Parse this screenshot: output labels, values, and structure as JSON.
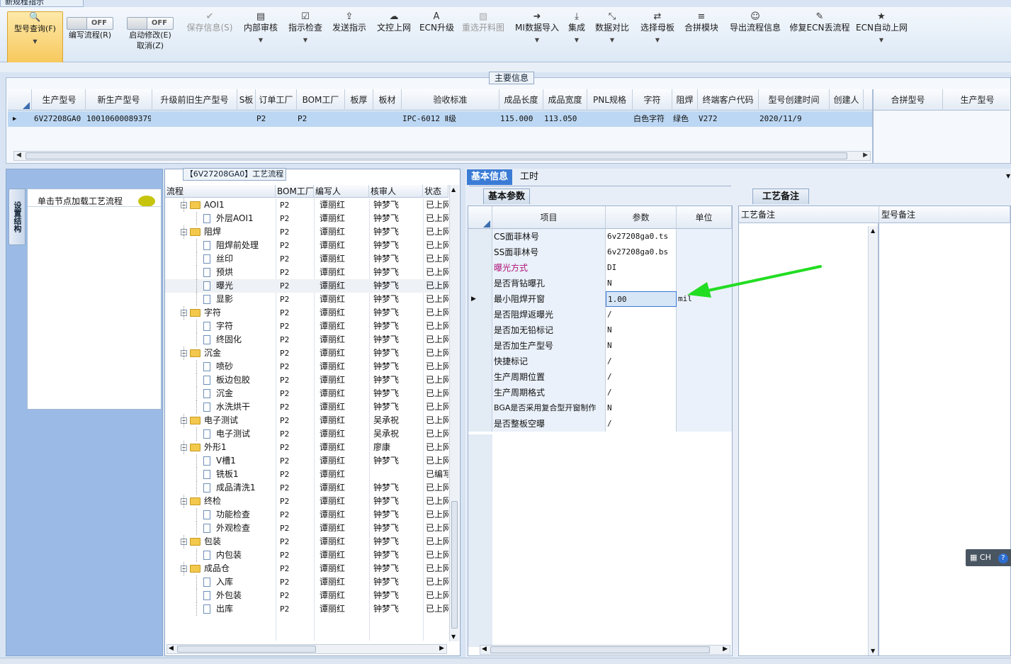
{
  "window": {
    "title": "新规程指示"
  },
  "toolbar": {
    "query": "型号查询(F)",
    "write_toggle": "OFF",
    "write": "编写流程(R)",
    "start_toggle": "OFF",
    "start": "启动修改(E)",
    "cancel": "取消(Z)",
    "items": [
      {
        "label": "保存信息(S)",
        "icon": "check-icon"
      },
      {
        "label": "内部审核",
        "icon": "print-icon"
      },
      {
        "label": "指示检查",
        "icon": "checkbox-icon"
      },
      {
        "label": "发送指示",
        "icon": "upload-icon"
      },
      {
        "label": "文控上网",
        "icon": "cloud-upload-icon"
      },
      {
        "label": "ECN升级",
        "icon": "font-icon"
      },
      {
        "label": "重选开料图",
        "icon": "image-icon"
      },
      {
        "label": "MI数据导入",
        "icon": "sign-in-icon"
      },
      {
        "label": "集成",
        "icon": "download-icon"
      },
      {
        "label": "数据对比",
        "icon": "compress-icon"
      },
      {
        "label": "选择母板",
        "icon": "random-icon"
      },
      {
        "label": "合拼模块",
        "icon": "list-icon"
      },
      {
        "label": "导出流程信息",
        "icon": "smile-icon"
      },
      {
        "label": "修复ECN丢流程",
        "icon": "wrench-icon"
      },
      {
        "label": "ECN自动上网",
        "icon": "star-icon"
      }
    ]
  },
  "main": {
    "section_title": "主要信息",
    "columns": [
      "生产型号",
      "新生产型号",
      "升级前旧生产型号",
      "S板",
      "订单工厂",
      "BOM工厂",
      "板厚",
      "板材",
      "验收标准",
      "成品长度",
      "成品宽度",
      "PNL规格",
      "字符",
      "阻焊",
      "终端客户代码",
      "型号创建时间",
      "创建人"
    ],
    "row": [
      "6V27208GA0",
      "10010600089379",
      "",
      "",
      "P2",
      "P2",
      "",
      "",
      "IPC-6012 Ⅱ级",
      "115.000",
      "113.050",
      "",
      "白色字符",
      "绿色",
      "V272",
      "2020/11/9",
      ""
    ],
    "side_columns": [
      "合拼型号",
      "生产型号"
    ]
  },
  "left": {
    "vertical_tab": "设置结构",
    "load_hint": "单击节点加载工艺流程"
  },
  "tree": {
    "title": "【6V27208GA0】工艺流程",
    "columns": [
      "流程",
      "BOM工厂",
      "编写人",
      "核审人",
      "状态"
    ],
    "rows": [
      {
        "name": "AOI1",
        "level": 0,
        "folder": true,
        "bom": "P2",
        "writer": "谭丽红",
        "reviewer": "钟梦飞",
        "status": "已上网"
      },
      {
        "name": "外层AOI1",
        "level": 1,
        "folder": false,
        "bom": "P2",
        "writer": "谭丽红",
        "reviewer": "钟梦飞",
        "status": "已上网"
      },
      {
        "name": "阻焊",
        "level": 0,
        "folder": true,
        "bom": "P2",
        "writer": "谭丽红",
        "reviewer": "钟梦飞",
        "status": "已上网"
      },
      {
        "name": "阻焊前处理",
        "level": 1,
        "folder": false,
        "bom": "P2",
        "writer": "谭丽红",
        "reviewer": "钟梦飞",
        "status": "已上网"
      },
      {
        "name": "丝印",
        "level": 1,
        "folder": false,
        "bom": "P2",
        "writer": "谭丽红",
        "reviewer": "钟梦飞",
        "status": "已上网"
      },
      {
        "name": "预烘",
        "level": 1,
        "folder": false,
        "bom": "P2",
        "writer": "谭丽红",
        "reviewer": "钟梦飞",
        "status": "已上网"
      },
      {
        "name": "曝光",
        "level": 1,
        "folder": false,
        "bom": "P2",
        "writer": "谭丽红",
        "reviewer": "钟梦飞",
        "status": "已上网",
        "selected": true
      },
      {
        "name": "显影",
        "level": 1,
        "folder": false,
        "bom": "P2",
        "writer": "谭丽红",
        "reviewer": "钟梦飞",
        "status": "已上网"
      },
      {
        "name": "字符",
        "level": 0,
        "folder": true,
        "bom": "P2",
        "writer": "谭丽红",
        "reviewer": "钟梦飞",
        "status": "已上网"
      },
      {
        "name": "字符",
        "level": 1,
        "folder": false,
        "bom": "P2",
        "writer": "谭丽红",
        "reviewer": "钟梦飞",
        "status": "已上网"
      },
      {
        "name": "终固化",
        "level": 1,
        "folder": false,
        "bom": "P2",
        "writer": "谭丽红",
        "reviewer": "钟梦飞",
        "status": "已上网"
      },
      {
        "name": "沉金",
        "level": 0,
        "folder": true,
        "bom": "P2",
        "writer": "谭丽红",
        "reviewer": "钟梦飞",
        "status": "已上网"
      },
      {
        "name": "喷砂",
        "level": 1,
        "folder": false,
        "bom": "P2",
        "writer": "谭丽红",
        "reviewer": "钟梦飞",
        "status": "已上网"
      },
      {
        "name": "板边包胶",
        "level": 1,
        "folder": false,
        "bom": "P2",
        "writer": "谭丽红",
        "reviewer": "钟梦飞",
        "status": "已上网"
      },
      {
        "name": "沉金",
        "level": 1,
        "folder": false,
        "bom": "P2",
        "writer": "谭丽红",
        "reviewer": "钟梦飞",
        "status": "已上网"
      },
      {
        "name": "水洗烘干",
        "level": 1,
        "folder": false,
        "bom": "P2",
        "writer": "谭丽红",
        "reviewer": "钟梦飞",
        "status": "已上网"
      },
      {
        "name": "电子测试",
        "level": 0,
        "folder": true,
        "bom": "P2",
        "writer": "谭丽红",
        "reviewer": "吴承祝",
        "status": "已上网"
      },
      {
        "name": "电子测试",
        "level": 1,
        "folder": false,
        "bom": "P2",
        "writer": "谭丽红",
        "reviewer": "吴承祝",
        "status": "已上网"
      },
      {
        "name": "外形1",
        "level": 0,
        "folder": true,
        "bom": "P2",
        "writer": "谭丽红",
        "reviewer": "廖康",
        "status": "已上网"
      },
      {
        "name": "V槽1",
        "level": 1,
        "folder": false,
        "bom": "P2",
        "writer": "谭丽红",
        "reviewer": "钟梦飞",
        "status": "已上网"
      },
      {
        "name": "铣板1",
        "level": 1,
        "folder": false,
        "bom": "P2",
        "writer": "谭丽红",
        "reviewer": "",
        "status": "已编写"
      },
      {
        "name": "成品清洗1",
        "level": 1,
        "folder": false,
        "bom": "P2",
        "writer": "谭丽红",
        "reviewer": "钟梦飞",
        "status": "已上网"
      },
      {
        "name": "终检",
        "level": 0,
        "folder": true,
        "bom": "P2",
        "writer": "谭丽红",
        "reviewer": "钟梦飞",
        "status": "已上网"
      },
      {
        "name": "功能检查",
        "level": 1,
        "folder": false,
        "bom": "P2",
        "writer": "谭丽红",
        "reviewer": "钟梦飞",
        "status": "已上网"
      },
      {
        "name": "外观检查",
        "level": 1,
        "folder": false,
        "bom": "P2",
        "writer": "谭丽红",
        "reviewer": "钟梦飞",
        "status": "已上网"
      },
      {
        "name": "包装",
        "level": 0,
        "folder": true,
        "bom": "P2",
        "writer": "谭丽红",
        "reviewer": "钟梦飞",
        "status": "已上网"
      },
      {
        "name": "内包装",
        "level": 1,
        "folder": false,
        "bom": "P2",
        "writer": "谭丽红",
        "reviewer": "钟梦飞",
        "status": "已上网"
      },
      {
        "name": "成品仓",
        "level": 0,
        "folder": true,
        "bom": "P2",
        "writer": "谭丽红",
        "reviewer": "钟梦飞",
        "status": "已上网"
      },
      {
        "name": "入库",
        "level": 1,
        "folder": false,
        "bom": "P2",
        "writer": "谭丽红",
        "reviewer": "钟梦飞",
        "status": "已上网"
      },
      {
        "name": "外包装",
        "level": 1,
        "folder": false,
        "bom": "P2",
        "writer": "谭丽红",
        "reviewer": "钟梦飞",
        "status": "已上网"
      },
      {
        "name": "出库",
        "level": 1,
        "folder": false,
        "bom": "P2",
        "writer": "谭丽红",
        "reviewer": "钟梦飞",
        "status": "已上网"
      }
    ]
  },
  "right": {
    "tabs": [
      "基本信息",
      "工时"
    ],
    "subtab": "基本参数",
    "param_columns": [
      "项目",
      "参数",
      "单位"
    ],
    "params": [
      {
        "item": "CS面菲林号",
        "value": "6v27208ga0.ts",
        "unit": ""
      },
      {
        "item": "SS面菲林号",
        "value": "6v27208ga0.bs",
        "unit": ""
      },
      {
        "item": "曝光方式",
        "value": "DI",
        "unit": "",
        "highlight": true
      },
      {
        "item": "是否背钻曝孔",
        "value": "N",
        "unit": ""
      },
      {
        "item": "最小阻焊开窗",
        "value": "1.00",
        "unit": "mil",
        "current": true
      },
      {
        "item": "是否阻焊返曝光",
        "value": "/",
        "unit": ""
      },
      {
        "item": "是否加无铅标记",
        "value": "N",
        "unit": ""
      },
      {
        "item": "是否加生产型号",
        "value": "N",
        "unit": ""
      },
      {
        "item": "快捷标记",
        "value": "/",
        "unit": ""
      },
      {
        "item": "生产周期位置",
        "value": "/",
        "unit": ""
      },
      {
        "item": "生产周期格式",
        "value": "/",
        "unit": ""
      },
      {
        "item": "BGA是否采用复合型开窗制作",
        "value": "N",
        "unit": ""
      },
      {
        "item": "是否整板空曝",
        "value": "/",
        "unit": ""
      }
    ],
    "notes_tab": "工艺备注",
    "notes_columns": [
      "工艺备注",
      "型号备注"
    ]
  },
  "ime": {
    "label": "CH"
  },
  "colors": {
    "accent": "#3a7bd5",
    "highlight_text": "#b0157a",
    "annotation_arrow": "#22dd22",
    "selected_row": "#bcd7f3"
  }
}
